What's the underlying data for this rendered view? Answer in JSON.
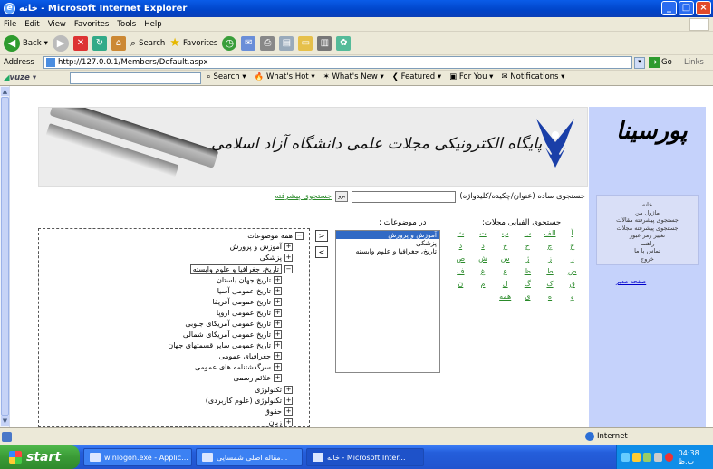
{
  "window": {
    "title": "خانه - Microsoft Internet Explorer"
  },
  "menu": [
    "File",
    "Edit",
    "View",
    "Favorites",
    "Tools",
    "Help"
  ],
  "toolbar": {
    "back": "Back",
    "search": "Search",
    "favorites": "Favorites"
  },
  "address": {
    "label": "Address",
    "url": "http://127.0.0.1/Members/Default.aspx",
    "go": "Go",
    "links": "Links"
  },
  "vuze": {
    "brand": "vuze",
    "items": [
      "Search",
      "What's Hot",
      "What's New",
      "Featured",
      "For You",
      "Notifications"
    ]
  },
  "banner": {
    "text": "پایگاه الکترونیکی مجلات علمی دانشگاه آزاد اسلامی"
  },
  "logo": {
    "text": "پورسینا"
  },
  "sidebar": {
    "menu": [
      "خانه",
      "ماژول من",
      "جستجوی پیشرفته مقالات",
      "جستجوی پیشرفته مجلات",
      "تغییر رمز عبور",
      "راهنما",
      "تماس با ما",
      "خروج"
    ],
    "admin_link": "صفحه مدیر"
  },
  "search": {
    "label": "جستجوی ساده (عنوان/چکیده/کلیدواژه)",
    "button": "برو",
    "advanced": "جستجوی پیشرفته"
  },
  "alpha": {
    "title": "جستجوی الفبایی مجلات:",
    "letters": [
      "آ",
      "الف",
      "ب",
      "پ",
      "ت",
      "ث",
      "ج",
      "چ",
      "ح",
      "خ",
      "د",
      "ذ",
      "ر",
      "ز",
      "ژ",
      "س",
      "ش",
      "ص",
      "ض",
      "ط",
      "ظ",
      "ع",
      "غ",
      "ف",
      "ق",
      "ک",
      "گ",
      "ل",
      "م",
      "ن",
      "و",
      "ه",
      "ی",
      "همه"
    ]
  },
  "subjects": {
    "title": "در موضوعات :",
    "selected": [
      "آموزش و پرورش",
      "پزشکی",
      "تاریخ، جغرافیا و علوم وابسته"
    ]
  },
  "tree": [
    {
      "label": "همه موضوعات",
      "sign": "−"
    },
    {
      "label": "آموزش و پرورش",
      "sign": "+"
    },
    {
      "label": "پزشکی",
      "sign": "+"
    },
    {
      "label": "تاریخ، جغرافیا و علوم وابسته",
      "sign": "−"
    },
    {
      "label": "تاریخ جهان باستان",
      "sign": "+"
    },
    {
      "label": "تاریخ عمومی آسیا",
      "sign": "+"
    },
    {
      "label": "تاریخ عمومی آفریقا",
      "sign": "+"
    },
    {
      "label": "تاریخ عمومی اروپا",
      "sign": "+"
    },
    {
      "label": "تاریخ عمومی آمریکای جنوبی",
      "sign": "+"
    },
    {
      "label": "تاریخ عمومی آمریکای شمالی",
      "sign": "+"
    },
    {
      "label": "تاریخ عمومی سایر قسمتهای جهان",
      "sign": "+"
    },
    {
      "label": "جغرافیای عمومی",
      "sign": "+"
    },
    {
      "label": "سرگذشتنامه های عمومی",
      "sign": "+"
    },
    {
      "label": "علائم رسمی",
      "sign": "+"
    },
    {
      "label": "تکنولوژی",
      "sign": "+"
    },
    {
      "label": "تکنولوژی (علوم کاربردی)",
      "sign": "+"
    },
    {
      "label": "حقوق",
      "sign": "+"
    },
    {
      "label": "زبان",
      "sign": "+"
    }
  ],
  "status": {
    "zone": "Internet"
  },
  "taskbar": {
    "start": "start",
    "tasks": [
      "winlogon.exe - Applic...",
      "مقاله اصلی شمسایی...",
      "خانه - Microsoft Inter..."
    ],
    "clock": "04:38 ب.ظ"
  }
}
